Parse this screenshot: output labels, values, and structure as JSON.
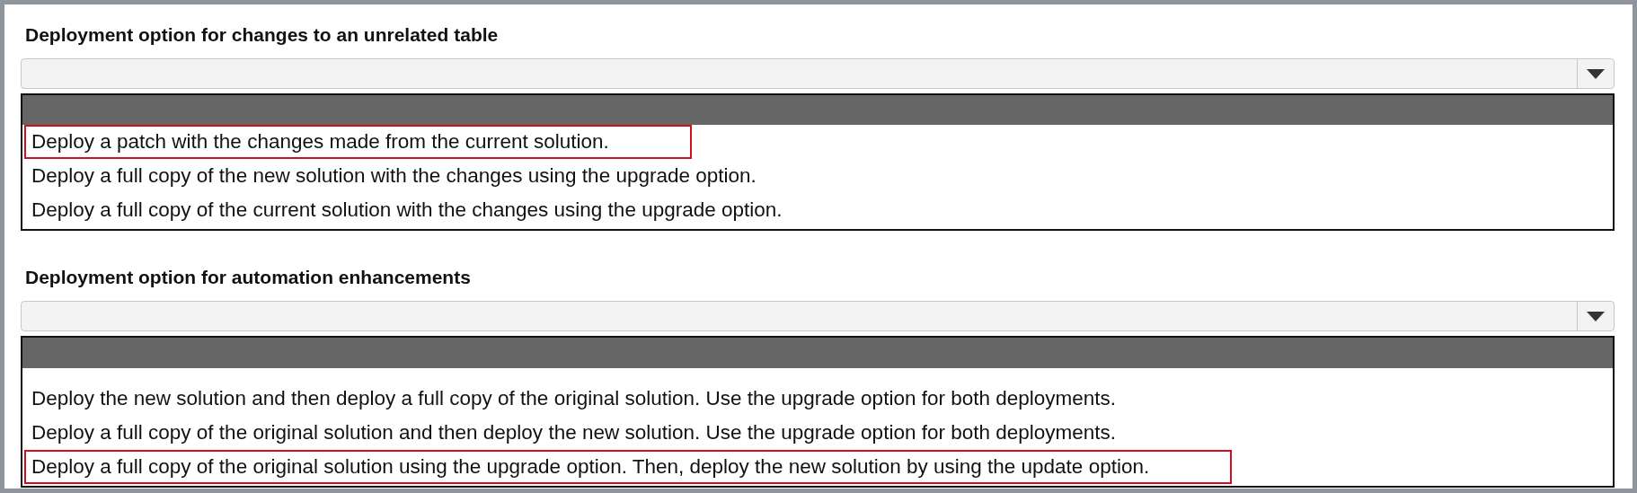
{
  "sections": [
    {
      "heading": "Deployment option for changes to an unrelated table",
      "options": [
        {
          "label": "Deploy a patch with the changes made from the current solution.",
          "selected": true
        },
        {
          "label": "Deploy a full copy of the new solution with the changes using the upgrade option.",
          "selected": false
        },
        {
          "label": "Deploy a full copy of the current solution with the changes using the upgrade option.",
          "selected": false
        }
      ]
    },
    {
      "heading": "Deployment option for automation enhancements",
      "options": [
        {
          "label": "Deploy the new solution and then deploy a full copy of the original solution. Use the upgrade option for both deployments.",
          "selected": false
        },
        {
          "label": "Deploy a full copy of the original solution and then deploy the new solution. Use the upgrade option for both deployments.",
          "selected": false
        },
        {
          "label": "Deploy a full copy of the original solution using the upgrade option. Then, deploy the new solution by using the update option.",
          "selected": true
        }
      ]
    }
  ]
}
